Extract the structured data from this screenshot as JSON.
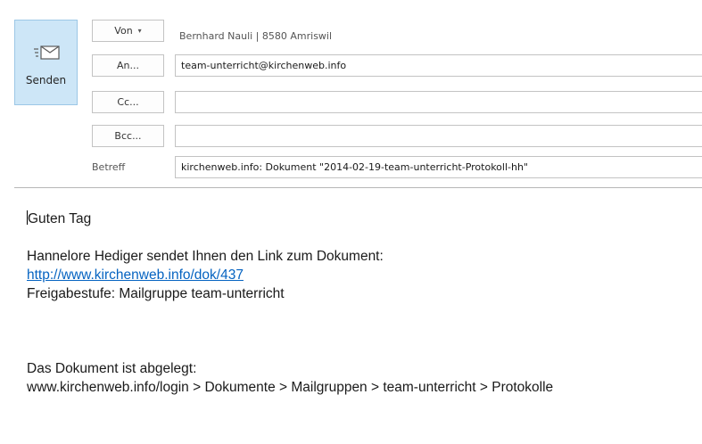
{
  "send": {
    "label": "Senden",
    "icon": "send-envelope-icon"
  },
  "from": {
    "label": "Von",
    "caret": "▾",
    "value": "Bernhard Nauli | 8580 Amriswil"
  },
  "to": {
    "label": "An...",
    "value": "team-unterricht@kirchenweb.info"
  },
  "cc": {
    "label": "Cc...",
    "value": ""
  },
  "bcc": {
    "label": "Bcc...",
    "value": ""
  },
  "subject": {
    "label": "Betreff",
    "value": "kirchenweb.info: Dokument \"2014-02-19-team-unterricht-Protokoll-hh\""
  },
  "body": {
    "greeting": "Guten Tag",
    "intro": "Hannelore Hediger sendet Ihnen den Link zum Dokument:",
    "link": "http://www.kirchenweb.info/dok/437",
    "share_level": "Freigabestufe: Mailgruppe team-unterricht",
    "location_intro": "Das Dokument ist abgelegt:",
    "location_path": "www.kirchenweb.info/login > Dokumente > Mailgruppen > team-unterricht > Protokolle"
  },
  "colors": {
    "send_bg": "#cde6f7",
    "link": "#0563c1",
    "border": "#c3c3c3"
  }
}
